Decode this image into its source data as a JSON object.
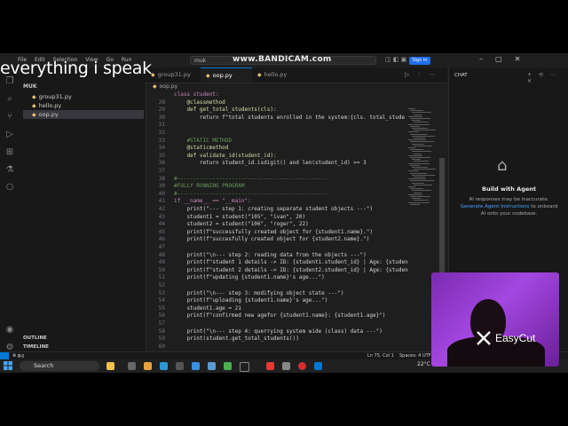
{
  "overlay": {
    "caption": "everything i speak",
    "watermark": "www.BANDICAM.com",
    "editor_brand": "EasyCut"
  },
  "titlebar": {
    "menu": [
      "File",
      "Edit",
      "Selection",
      "View",
      "Go",
      "Run"
    ],
    "search": "muk",
    "sign_in": "Sign in"
  },
  "explorer": {
    "folder": "MUK",
    "files": [
      "group31.py",
      "hello.py",
      "oop.py"
    ],
    "selected": "oop.py",
    "outline_label": "OUTLINE",
    "timeline_label": "TIMELINE"
  },
  "tabs": [
    "group31.py",
    "oop.py",
    "hello.py"
  ],
  "active_tab": "oop.py",
  "breadcrumb": "oop.py",
  "code": [
    {
      "n": "",
      "t": "class student:",
      "k": "kw"
    },
    {
      "n": "28",
      "t": "    @classmethod",
      "k": "dec"
    },
    {
      "n": "29",
      "t": "    def get_total_students(cls):",
      "k": "fn"
    },
    {
      "n": "30",
      "t": "        return f\"total students enrolled in the system:{cls. total_stude",
      "k": "pl"
    },
    {
      "n": "31",
      "t": "",
      "k": "pl"
    },
    {
      "n": "32",
      "t": "",
      "k": "pl"
    },
    {
      "n": "33",
      "t": "    #STATIC METHOD",
      "k": "cm"
    },
    {
      "n": "34",
      "t": "    @staticmethod",
      "k": "dec"
    },
    {
      "n": "35",
      "t": "    def validate_id(student_id):",
      "k": "fn"
    },
    {
      "n": "36",
      "t": "        return student_id.isdigit() and len(student_id) >= 3",
      "k": "pl"
    },
    {
      "n": "37",
      "t": "",
      "k": "pl"
    },
    {
      "n": "38",
      "t": "#-----------------------------------------------",
      "k": "cm"
    },
    {
      "n": "39",
      "t": "#FULLY RUNNING PROGRAM",
      "k": "cm"
    },
    {
      "n": "40",
      "t": "#-----------------------------------------------",
      "k": "cm"
    },
    {
      "n": "41",
      "t": "if __name__ == \"__main\":",
      "k": "kw"
    },
    {
      "n": "42",
      "t": "    print(\"--- step 1: creating separate student objects ---\")",
      "k": "pl"
    },
    {
      "n": "43",
      "t": "    student1 = student(\"105\", \"ivan\", 20)",
      "k": "pl"
    },
    {
      "n": "44",
      "t": "    student2 = student(\"106\", \"roger\", 22)",
      "k": "pl"
    },
    {
      "n": "45",
      "t": "    print(f\"successfully created object for {student1.name}.\")",
      "k": "pl"
    },
    {
      "n": "46",
      "t": "    print(f\"succesfully created object for {student2.name}.\")",
      "k": "pl"
    },
    {
      "n": "47",
      "t": "",
      "k": "pl"
    },
    {
      "n": "48",
      "t": "    print(\"\\n--- step 2: reading data from the objects ---\")",
      "k": "pl"
    },
    {
      "n": "49",
      "t": "    print(f\"student 1 details -> ID: {student1.student_id} | Age: {studen",
      "k": "pl"
    },
    {
      "n": "50",
      "t": "    print(f\"student 2 details -> ID: {student2.student_id} | Age: {studen",
      "k": "pl"
    },
    {
      "n": "51",
      "t": "    print(f\"updating {student1.name}'s age...\")",
      "k": "pl"
    },
    {
      "n": "52",
      "t": "",
      "k": "pl"
    },
    {
      "n": "53",
      "t": "    print(\"\\n--- step 3: modifying object state ---\")",
      "k": "pl"
    },
    {
      "n": "54",
      "t": "    print(f\"uploading {student1.name}'s age...\")",
      "k": "pl"
    },
    {
      "n": "55",
      "t": "    student1.age = 21",
      "k": "pl"
    },
    {
      "n": "56",
      "t": "    print(f\"confirmed new agefor {student1.name}: {student1.age}\")",
      "k": "pl"
    },
    {
      "n": "57",
      "t": "",
      "k": "pl"
    },
    {
      "n": "58",
      "t": "    print(\"\\n--- step 4: querrying system wide (class) data ---\")",
      "k": "pl"
    },
    {
      "n": "59",
      "t": "    print(student.get_total_students())",
      "k": "pl"
    },
    {
      "n": "60",
      "t": "",
      "k": "pl"
    }
  ],
  "chat": {
    "header": "CHAT",
    "title": "Build with Agent",
    "msg1": "AI responses may be inaccurate.",
    "link": "Generate Agent Instructions",
    "msg2": "to onboard AI onto your codebase."
  },
  "status": {
    "errors": "0",
    "warnings": "0",
    "position": "Ln 75, Col 1",
    "spaces": "Spaces: 4",
    "encoding": "UTF-8"
  },
  "taskbar": {
    "search": "Search",
    "weather": "22°C"
  },
  "colors": {
    "accent": "#0078d4",
    "editor_bg": "#1e1e1e",
    "webcam": "#a347e0"
  }
}
